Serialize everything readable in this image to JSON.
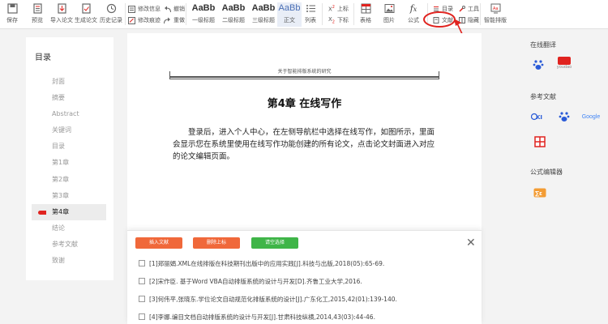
{
  "toolbar": {
    "save": "保存",
    "preview": "预览",
    "import_paper": "导入论文",
    "generate_paper": "生成论文",
    "history": "历史记录",
    "track_info": "修改信息",
    "track_mark": "修改痕迹",
    "undo": "撤销",
    "redo": "重做",
    "h1_big": "AaBb",
    "h1_label": "一级标题",
    "h2_big": "AaBb",
    "h2_label": "二级标题",
    "h3_big": "AaBb",
    "h3_label": "三级标题",
    "body_big": "AaBb",
    "body_label": "正文",
    "list": "列表",
    "superscript": "上标",
    "subscript": "下标",
    "table": "表格",
    "image": "图片",
    "formula": "公式",
    "toc": "目录",
    "tools": "工具",
    "references": "文献",
    "hide": "隐藏",
    "smart_layout": "智能排版"
  },
  "sidebar": {
    "title": "目录",
    "items": [
      "封面",
      "摘要",
      "Abstract",
      "关键词",
      "目录",
      "第1章",
      "第2章",
      "第3章",
      "第4章",
      "结论",
      "参考文献",
      "致谢"
    ],
    "active_index": 8
  },
  "document": {
    "header": "关于智能排版系统的研究",
    "chapter_title": "第4章 在线写作",
    "paragraph": "登录后，进入个人中心，在左侧导航栏中选择在线写作，如图所示，里面会显示您在系统里使用在线写作功能创建的所有论文，点击论文封面进入对应的论文编辑页面。"
  },
  "ref_panel": {
    "insert_button": "插入文献",
    "remove_superscript_button": "删除上标",
    "clear_selection_button": "请空选择",
    "close": "✕",
    "references": [
      "[1]郑丽娟.XML在线排版在科技期刊出版中的应用实践[J].科技与出版,2018(05):65-69.",
      "[2]宋作臣. 基于Word VBA自动排版系统的设计与开发[D].齐鲁工业大学,2016.",
      "[3]何伟平,张晓东.学位论文自动规范化排版系统的设计[J].广东化工,2015,42(01):139-140.",
      "[4]李娜.编目文档自动排版系统的设计与开发[J].甘肃科技纵横,2014,43(03):44-46."
    ]
  },
  "right_sidebar": {
    "online_translate": "在线翻译",
    "baidu_label": "",
    "youdao_label": "youdao",
    "references_title": "参考文献",
    "google_label": "Google",
    "formula_editor": "公式编辑器",
    "cnki_label": "CNKI"
  },
  "colors": {
    "accent_red": "#e0231f",
    "btn_orange": "#f0683a",
    "btn_green": "#3fb548",
    "toc_active_bg": "#ececec"
  }
}
